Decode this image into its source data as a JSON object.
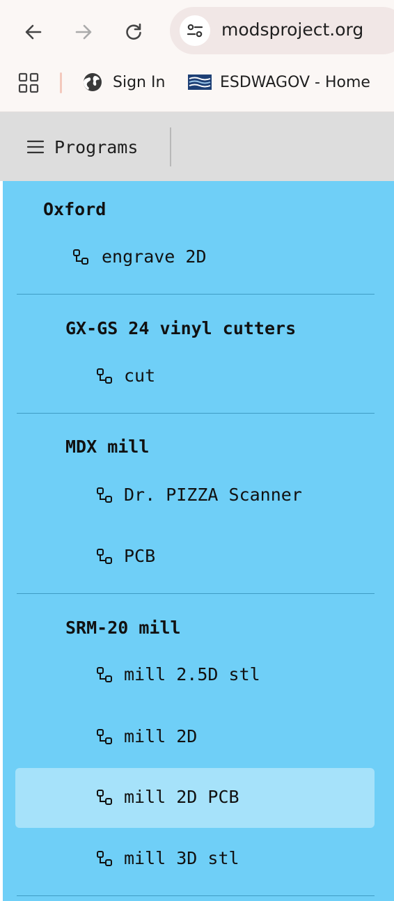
{
  "browser": {
    "url": "modsproject.org",
    "bookmarks": [
      {
        "label": "Sign In",
        "icon": "globe-icon"
      },
      {
        "label": "ESDWAGOV - Home",
        "icon": "esdwagov-logo-icon"
      }
    ]
  },
  "header": {
    "menu_label": "Programs",
    "menu_icon": "hamburger-icon"
  },
  "programs": {
    "groups": [
      {
        "title": "Oxford",
        "items": [
          {
            "label": "engrave 2D"
          }
        ]
      },
      {
        "title": "GX-GS 24 vinyl cutters",
        "items": [
          {
            "label": "cut"
          }
        ]
      },
      {
        "title": "MDX mill",
        "items": [
          {
            "label": "Dr. PIZZA Scanner"
          },
          {
            "label": "PCB"
          }
        ]
      },
      {
        "title": "SRM-20 mill",
        "items": [
          {
            "label": "mill 2.5D stl"
          },
          {
            "label": "mill 2D"
          },
          {
            "label": "mill 2D PCB",
            "active": true
          },
          {
            "label": "mill 3D stl"
          }
        ]
      }
    ]
  },
  "colors": {
    "panel_bg": "#6fcff7",
    "active_item_bg": "#a6e2fa",
    "header_bg": "#dddddd",
    "chrome_bg": "#fbf7f5"
  }
}
